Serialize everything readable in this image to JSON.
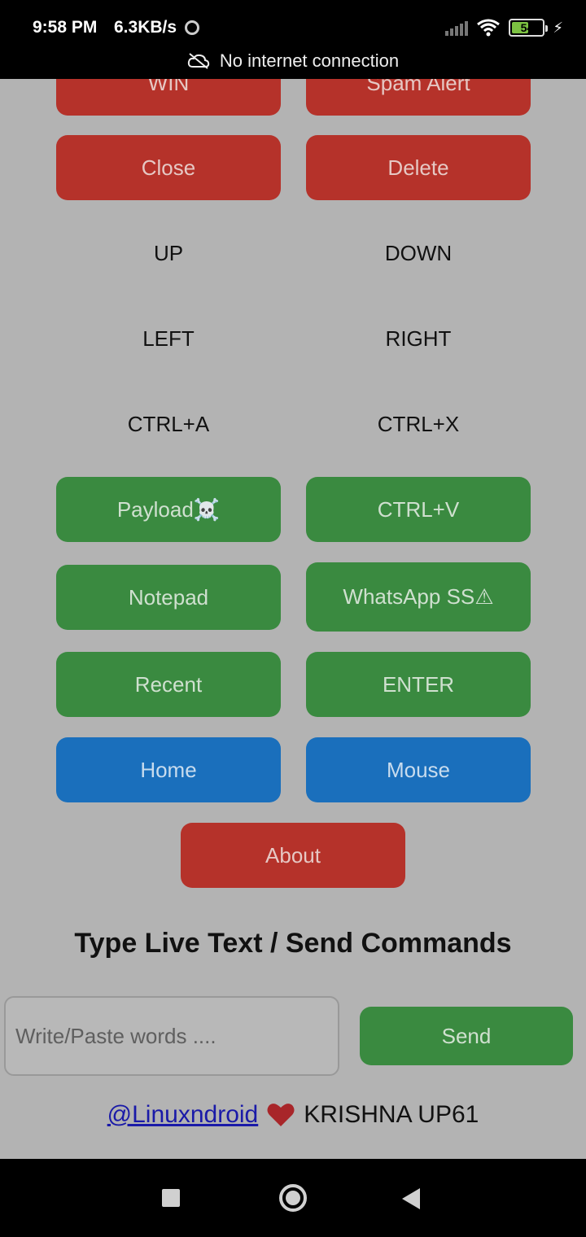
{
  "status_bar": {
    "time": "9:58 PM",
    "speed": "6.3KB/s",
    "battery_level": "54",
    "network_message": "No internet connection"
  },
  "buttons": {
    "win": "WIN",
    "spam_alert": "Spam Alert",
    "close": "Close",
    "delete": "Delete",
    "up": "UP",
    "down": "DOWN",
    "left": "LEFT",
    "right": "RIGHT",
    "ctrl_a": "CTRL+A",
    "ctrl_x": "CTRL+X",
    "payload": "Payload☠️",
    "ctrl_v": "CTRL+V",
    "notepad": "Notepad",
    "whatsapp_ss": "WhatsApp SS⚠",
    "recent": "Recent",
    "enter": "ENTER",
    "home": "Home",
    "mouse": "Mouse",
    "about": "About"
  },
  "live_text": {
    "title": "Type Live Text / Send Commands",
    "placeholder": "Write/Paste words ....",
    "value": "",
    "send_label": "Send"
  },
  "footer": {
    "link": "@Linuxndroid",
    "credit": "KRISHNA UP61"
  },
  "colors": {
    "red": "#b5322a",
    "green": "#3a8a40",
    "blue": "#1a6fbc",
    "background": "#b3b3b3"
  }
}
